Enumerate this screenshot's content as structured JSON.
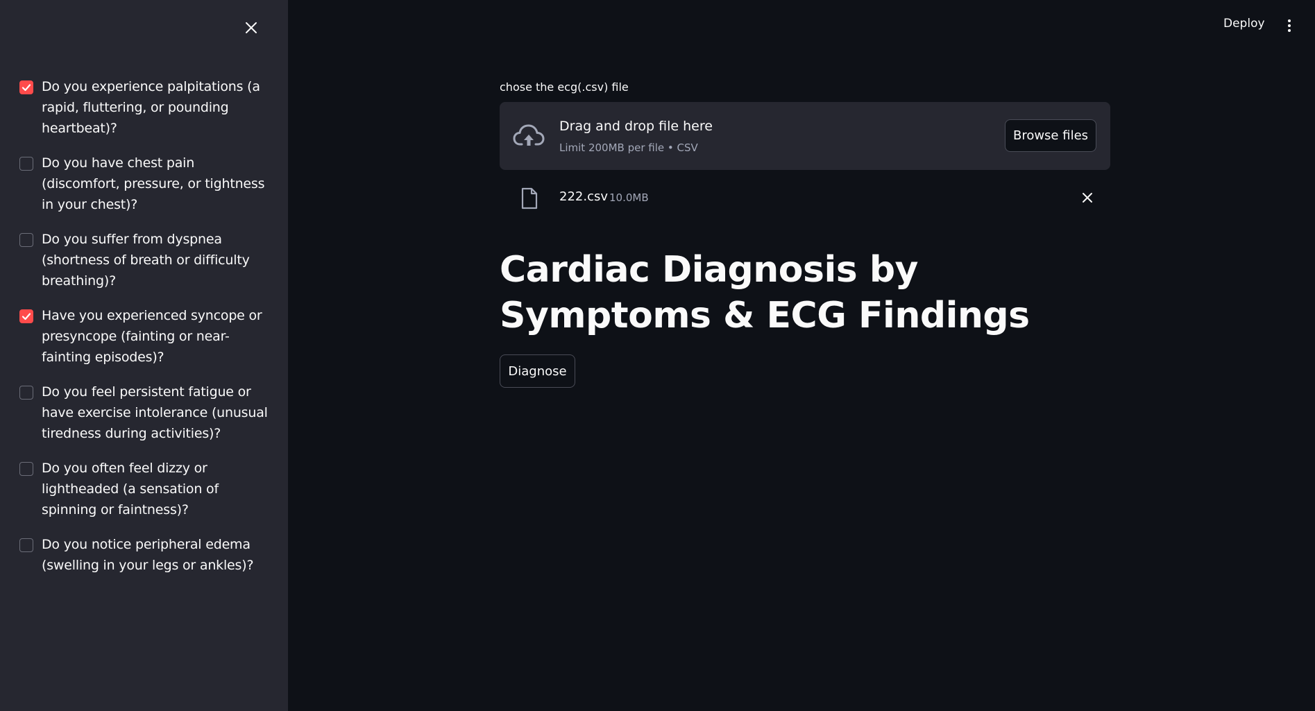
{
  "sidebar": {
    "items": [
      {
        "label": "Do you experience palpitations (a rapid, fluttering, or pounding heartbeat)?",
        "checked": true
      },
      {
        "label": "Do you have chest pain (discomfort, pressure, or tightness in your chest)?",
        "checked": false
      },
      {
        "label": "Do you suffer from dyspnea (shortness of breath or difficulty breathing)?",
        "checked": false
      },
      {
        "label": "Have you experienced syncope or presyncope (fainting or near-fainting episodes)?",
        "checked": true
      },
      {
        "label": "Do you feel persistent fatigue or have exercise intolerance (unusual tiredness during activities)?",
        "checked": false
      },
      {
        "label": "Do you often feel dizzy or lightheaded (a sensation of spinning or faintness)?",
        "checked": false
      },
      {
        "label": "Do you notice peripheral edema (swelling in your legs or ankles)?",
        "checked": false
      }
    ]
  },
  "header": {
    "deploy_label": "Deploy"
  },
  "uploader": {
    "label": "chose the ecg(.csv) file",
    "drop_title": "Drag and drop file here",
    "drop_subtitle": "Limit 200MB per file • CSV",
    "browse_label": "Browse files",
    "file": {
      "name": "222.csv",
      "size": "10.0MB"
    }
  },
  "main": {
    "title": "Cardiac Diagnosis by Symptoms & ECG Findings",
    "diagnose_label": "Diagnose"
  },
  "colors": {
    "accent": "#ff4b4b",
    "sidebar_bg": "#262730",
    "main_bg": "#0e1117"
  },
  "icons": {
    "sidebar_close": "close-icon",
    "upload": "cloud-upload-icon",
    "file": "file-icon",
    "file_remove": "close-icon",
    "menu": "kebab-menu-icon"
  }
}
